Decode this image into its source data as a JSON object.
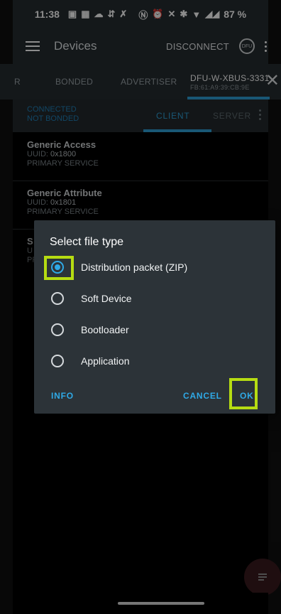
{
  "status": {
    "time": "11:38",
    "battery": "87 %",
    "icons": [
      "linkedin-icon",
      "teams-icon",
      "cloud-icon",
      "signal-boost-icon",
      "sparkle-icon",
      "nfc-icon",
      "alarm-icon",
      "mute-icon",
      "bluetooth-icon",
      "wifi-icon",
      "signal-icon",
      "signal-icon"
    ]
  },
  "appbar": {
    "title": "Devices",
    "disconnect": "DISCONNECT",
    "dfu_label": "DFU"
  },
  "tabs": {
    "partial": "R",
    "bonded": "BONDED",
    "advertiser": "ADVERTISER",
    "device_name": "DFU-W-XBUS-3331",
    "device_addr": "FB:61:A9:39:CB:9E",
    "close": "✕"
  },
  "subbar": {
    "connected": "CONNECTED",
    "bonding": "NOT BONDED",
    "client": "CLIENT",
    "server": "SERVER"
  },
  "services": [
    {
      "name": "Generic Access",
      "uuid_label": "UUID: ",
      "uuid": "0x1800",
      "type": "PRIMARY SERVICE"
    },
    {
      "name": "Generic Attribute",
      "uuid_label": "UUID: ",
      "uuid": "0x1801",
      "type": "PRIMARY SERVICE"
    },
    {
      "name": "S",
      "uuid_label": "U",
      "uuid": "",
      "type": "PR"
    }
  ],
  "dialog": {
    "title": "Select file type",
    "options": [
      {
        "label": "Distribution packet (ZIP)",
        "selected": true
      },
      {
        "label": "Soft Device",
        "selected": false
      },
      {
        "label": "Bootloader",
        "selected": false
      },
      {
        "label": "Application",
        "selected": false
      }
    ],
    "info": "INFO",
    "cancel": "CANCEL",
    "ok": "OK"
  },
  "colors": {
    "accent": "#2fa9e6",
    "highlight": "#b6dc12",
    "bar": "#262c30",
    "dialog": "#2c3338"
  }
}
